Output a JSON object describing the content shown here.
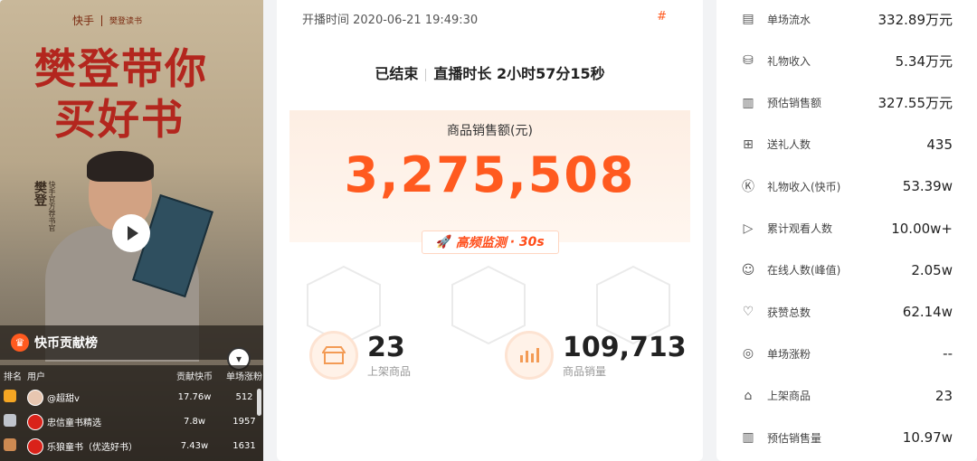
{
  "video": {
    "brand_left": "快手",
    "brand_right": "樊登读书",
    "cover_line1": "樊登带你",
    "cover_line2": "买好书",
    "seal_text": "快手官方",
    "host_name": "樊登",
    "host_sub": "快手官方荐书官",
    "contrib_title": "快币贡献榜",
    "table_headers": [
      "排名",
      "用户",
      "贡献快币",
      "单场涨粉"
    ],
    "rows": [
      {
        "user": "@超甜v",
        "coins": "17.76w",
        "fans": "512",
        "medal_color": "#f5a623"
      },
      {
        "user": "忠信童书精选",
        "coins": "7.8w",
        "fans": "1957",
        "medal_color": "#c0c4cc"
      },
      {
        "user": "乐狼童书（优选好书）",
        "coins": "7.43w",
        "fans": "1631",
        "medal_color": "#cd8a52"
      }
    ]
  },
  "middle": {
    "open_time": "开播时间 2020-06-21 19:49:30",
    "hash": "#",
    "status": "已结束",
    "duration": "直播时长 2小时57分15秒",
    "sales_label": "商品销售额(元)",
    "sales_value": "3,275,508",
    "monitor_label": "高频监测",
    "monitor_interval": "· 30s",
    "kpis": [
      {
        "value": "23",
        "label": "上架商品",
        "icon": "shop-icon"
      },
      {
        "value": "109,713",
        "label": "商品销量",
        "icon": "bar-chart-icon"
      }
    ]
  },
  "stats": [
    {
      "label": "单场流水",
      "value": "332.89万元",
      "icon": "receipt-icon",
      "glyph": "▤"
    },
    {
      "label": "礼物收入",
      "value": "5.34万元",
      "icon": "coins-icon",
      "glyph": "⛁"
    },
    {
      "label": "预估销售额",
      "value": "327.55万元",
      "icon": "sales-estimate-icon",
      "glyph": "▥"
    },
    {
      "label": "送礼人数",
      "value": "435",
      "icon": "gift-icon",
      "glyph": "⊞"
    },
    {
      "label": "礼物收入(快币)",
      "value": "53.39w",
      "icon": "k-coin-icon",
      "glyph": "Ⓚ"
    },
    {
      "label": "累计观看人数",
      "value": "10.00w+",
      "icon": "play-circle-icon",
      "glyph": "▷"
    },
    {
      "label": "在线人数(峰值)",
      "value": "2.05w",
      "icon": "users-icon",
      "glyph": "☺"
    },
    {
      "label": "获赞总数",
      "value": "62.14w",
      "icon": "heart-icon",
      "glyph": "♡"
    },
    {
      "label": "单场涨粉",
      "value": "--",
      "icon": "fans-icon",
      "glyph": "◎"
    },
    {
      "label": "上架商品",
      "value": "23",
      "icon": "shop-icon",
      "glyph": "⌂"
    },
    {
      "label": "预估销售量",
      "value": "10.97w",
      "icon": "bar-chart-icon",
      "glyph": "▥"
    }
  ]
}
